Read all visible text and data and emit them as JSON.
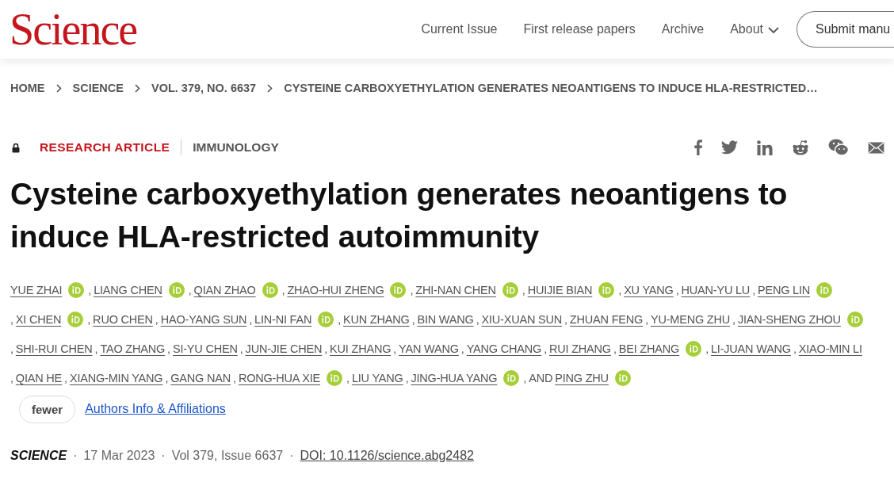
{
  "header": {
    "logo": "Science",
    "nav": [
      {
        "label": "Current Issue",
        "dropdown": false
      },
      {
        "label": "First release papers",
        "dropdown": false
      },
      {
        "label": "Archive",
        "dropdown": false
      },
      {
        "label": "About",
        "dropdown": true
      }
    ],
    "submit_button": "Submit manu"
  },
  "breadcrumbs": {
    "items": [
      "HOME",
      "SCIENCE",
      "VOL. 379, NO. 6637",
      "CYSTEINE CARBOXYETHYLATION GENERATES NEOANTIGENS TO INDUCE HLA-RESTRICTED…"
    ]
  },
  "article": {
    "locked": true,
    "type": "RESEARCH ARTICLE",
    "subject": "IMMUNOLOGY",
    "title": "Cysteine carboxyethylation generates neoantigens to induce HLA-restricted autoimmunity",
    "authors": {
      "separator": ",",
      "final_separator": ", AND",
      "list": [
        {
          "name": "YUE ZHAI",
          "orcid": true
        },
        {
          "name": "LIANG CHEN",
          "orcid": true
        },
        {
          "name": "QIAN ZHAO",
          "orcid": true
        },
        {
          "name": "ZHAO-HUI ZHENG",
          "orcid": true
        },
        {
          "name": "ZHI-NAN CHEN",
          "orcid": true
        },
        {
          "name": "HUIJIE BIAN",
          "orcid": true
        },
        {
          "name": "XU YANG",
          "orcid": false
        },
        {
          "name": "HUAN-YU LU",
          "orcid": false
        },
        {
          "name": "PENG LIN",
          "orcid": true
        },
        {
          "name": "XI CHEN",
          "orcid": true
        },
        {
          "name": "RUO CHEN",
          "orcid": false
        },
        {
          "name": "HAO-YANG SUN",
          "orcid": false
        },
        {
          "name": "LIN-NI FAN",
          "orcid": true
        },
        {
          "name": "KUN ZHANG",
          "orcid": false
        },
        {
          "name": "BIN WANG",
          "orcid": false
        },
        {
          "name": "XIU-XUAN SUN",
          "orcid": false
        },
        {
          "name": "ZHUAN FENG",
          "orcid": false
        },
        {
          "name": "YU-MENG ZHU",
          "orcid": false
        },
        {
          "name": "JIAN-SHENG ZHOU",
          "orcid": true
        },
        {
          "name": "SHI-RUI CHEN",
          "orcid": false
        },
        {
          "name": "TAO ZHANG",
          "orcid": false
        },
        {
          "name": "SI-YU CHEN",
          "orcid": false
        },
        {
          "name": "JUN-JIE CHEN",
          "orcid": false
        },
        {
          "name": "KUI ZHANG",
          "orcid": false
        },
        {
          "name": "YAN WANG",
          "orcid": false
        },
        {
          "name": "YANG CHANG",
          "orcid": false
        },
        {
          "name": "RUI ZHANG",
          "orcid": false
        },
        {
          "name": "BEI ZHANG",
          "orcid": true
        },
        {
          "name": "LI-JUAN WANG",
          "orcid": false
        },
        {
          "name": "XIAO-MIN LI",
          "orcid": false
        },
        {
          "name": "QIAN HE",
          "orcid": false
        },
        {
          "name": "XIANG-MIN YANG",
          "orcid": false
        },
        {
          "name": "GANG NAN",
          "orcid": false
        },
        {
          "name": "RONG-HUA XIE",
          "orcid": true
        },
        {
          "name": "LIU YANG",
          "orcid": false
        },
        {
          "name": "JING-HUA YANG",
          "orcid": true
        },
        {
          "name": "PING ZHU",
          "orcid": true
        }
      ]
    },
    "fewer_button": "fewer",
    "affiliations_link": "Authors Info & Affiliations",
    "meta": {
      "separator": "·",
      "journal": "SCIENCE",
      "date": "17 Mar 2023",
      "issue": "Vol 379, Issue 6637",
      "doi": "DOI: 10.1126/science.abg2482"
    }
  }
}
